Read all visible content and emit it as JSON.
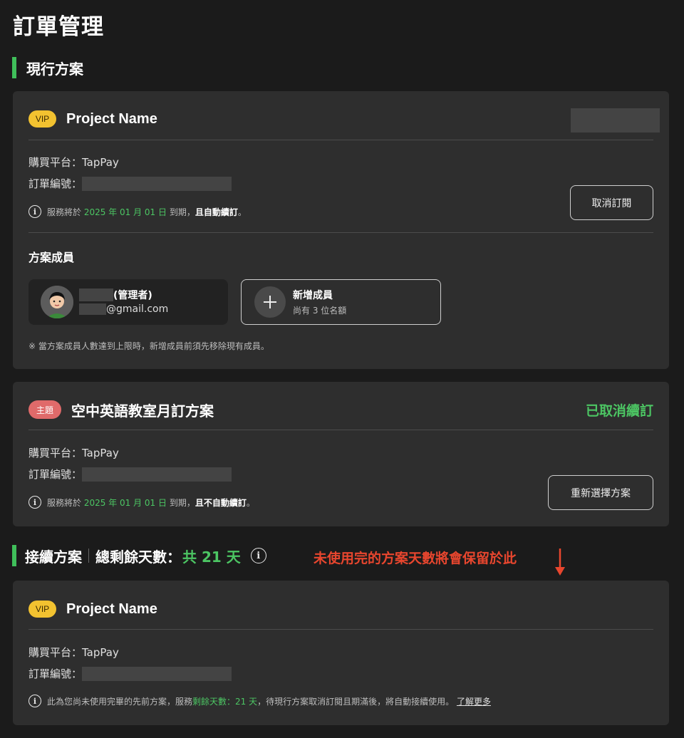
{
  "page": {
    "title": "訂單管理"
  },
  "current_section": {
    "title": "現行方案"
  },
  "current_plan": {
    "badge": "VIP",
    "name": "Project Name",
    "platform": "購買平台：TapPay",
    "order_no_label": "訂單編號：",
    "note_prefix": "服務將於",
    "note_date": "2025 年 01 月 01 日",
    "note_mid": "到期，",
    "note_bold": "且自動續訂",
    "note_end": "。",
    "cancel_button": "取消訂閱",
    "members_title": "方案成員",
    "member": {
      "role": "(管理者)",
      "email_suffix": "@gmail.com"
    },
    "add_member": {
      "title": "新增成員",
      "sub": "尚有 3 位名額"
    },
    "members_note": "※ 當方案成員人數達到上限時，新增成員前須先移除現有成員。"
  },
  "topic_plan": {
    "badge": "主題",
    "name": "空中英語教室月訂方案",
    "status": "已取消續訂",
    "status_color": "#4cc563",
    "platform": "購買平台：TapPay",
    "order_no_label": "訂單編號：",
    "note_prefix": "服務將於",
    "note_date": "2025 年 01 月 01 日",
    "note_mid": "到期，",
    "note_bold": "且不自動續訂",
    "note_end": "。",
    "reselect_button": "重新選擇方案"
  },
  "continue_section": {
    "title": "接續方案",
    "total_label": "總剩餘天數：",
    "total_value": "共 21 天",
    "annotation": "未使用完的方案天數將會保留於此"
  },
  "continue_plan": {
    "badge": "VIP",
    "name": "Project Name",
    "platform": "購買平台：TapPay",
    "order_no_label": "訂單編號：",
    "note_prefix": "此為您尚未使用完畢的先前方案，服務",
    "note_green": "剩餘天數：21 天",
    "note_suffix": "，待現行方案取消訂閱且期滿後，將自動接續使用。",
    "learn_more": "了解更多"
  },
  "colors": {
    "accent_green": "#4cc563",
    "vip_yellow": "#f2c230",
    "topic_red": "#e06a6a",
    "annotation_red": "#e8462e"
  },
  "icons": [
    "info-icon",
    "plus-icon",
    "avatar",
    "arrow-down-icon"
  ]
}
